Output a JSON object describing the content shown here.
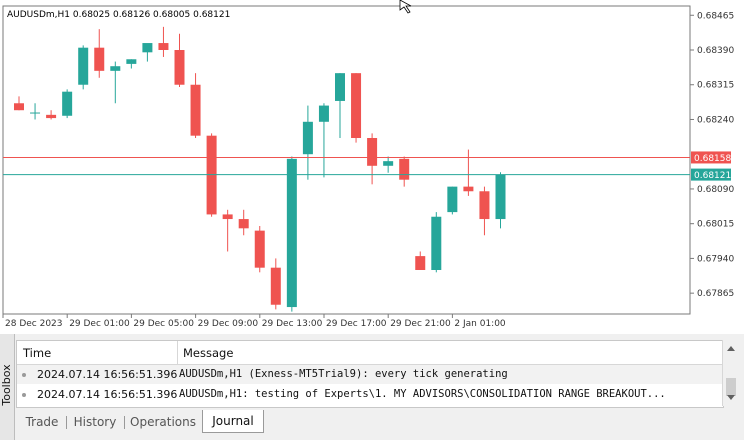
{
  "chart": {
    "symbol_info": "AUDUSDm,H1  0.68025 0.68126 0.68005 0.68121",
    "bid_label": "0.68121",
    "ask_label": "0.68158",
    "bull_color": "#26a69a",
    "bear_color": "#ef5350",
    "bid_line_color": "#26a69a",
    "ask_line_color": "#ef5350"
  },
  "chart_data": {
    "type": "candlestick",
    "symbol": "AUDUSDm",
    "timeframe": "H1",
    "ylim": [
      0.6782,
      0.68485
    ],
    "y_ticks": [
      "0.68465",
      "0.68390",
      "0.68315",
      "0.68240",
      "0.68090",
      "0.68015",
      "0.67940",
      "0.67865"
    ],
    "x_ticks": [
      "28 Dec 2023",
      "29 Dec 01:00",
      "29 Dec 05:00",
      "29 Dec 09:00",
      "29 Dec 13:00",
      "29 Dec 17:00",
      "29 Dec 21:00",
      "2 Jan 01:00"
    ],
    "candles": [
      {
        "o": 0.68275,
        "h": 0.6829,
        "l": 0.6826,
        "c": 0.6826
      },
      {
        "o": 0.68255,
        "h": 0.68275,
        "l": 0.6824,
        "c": 0.68255
      },
      {
        "o": 0.6825,
        "h": 0.6826,
        "l": 0.6824,
        "c": 0.68243
      },
      {
        "o": 0.68248,
        "h": 0.68305,
        "l": 0.68243,
        "c": 0.683
      },
      {
        "o": 0.68315,
        "h": 0.684,
        "l": 0.68305,
        "c": 0.68395
      },
      {
        "o": 0.68395,
        "h": 0.68435,
        "l": 0.6833,
        "c": 0.68345
      },
      {
        "o": 0.68345,
        "h": 0.68365,
        "l": 0.68275,
        "c": 0.68355
      },
      {
        "o": 0.6836,
        "h": 0.6837,
        "l": 0.6835,
        "c": 0.6837
      },
      {
        "o": 0.68385,
        "h": 0.68395,
        "l": 0.68365,
        "c": 0.68405
      },
      {
        "o": 0.68405,
        "h": 0.6844,
        "l": 0.68375,
        "c": 0.6839
      },
      {
        "o": 0.6839,
        "h": 0.68425,
        "l": 0.6831,
        "c": 0.68315
      },
      {
        "o": 0.68315,
        "h": 0.6834,
        "l": 0.682,
        "c": 0.68205
      },
      {
        "o": 0.68205,
        "h": 0.6821,
        "l": 0.6803,
        "c": 0.68035
      },
      {
        "o": 0.68035,
        "h": 0.68045,
        "l": 0.67955,
        "c": 0.68025
      },
      {
        "o": 0.68025,
        "h": 0.68045,
        "l": 0.6799,
        "c": 0.68005
      },
      {
        "o": 0.68,
        "h": 0.6801,
        "l": 0.6791,
        "c": 0.6792
      },
      {
        "o": 0.6792,
        "h": 0.6794,
        "l": 0.6783,
        "c": 0.6784
      },
      {
        "o": 0.67835,
        "h": 0.6816,
        "l": 0.67825,
        "c": 0.68155
      },
      {
        "o": 0.68165,
        "h": 0.6827,
        "l": 0.6811,
        "c": 0.68235
      },
      {
        "o": 0.68235,
        "h": 0.68275,
        "l": 0.68115,
        "c": 0.6827
      },
      {
        "o": 0.6828,
        "h": 0.6834,
        "l": 0.682,
        "c": 0.6834
      },
      {
        "o": 0.6834,
        "h": 0.6834,
        "l": 0.6819,
        "c": 0.682
      },
      {
        "o": 0.682,
        "h": 0.6821,
        "l": 0.681,
        "c": 0.6814
      },
      {
        "o": 0.6814,
        "h": 0.6816,
        "l": 0.68125,
        "c": 0.6815
      },
      {
        "o": 0.68155,
        "h": 0.6816,
        "l": 0.68095,
        "c": 0.6811
      },
      {
        "o": 0.67945,
        "h": 0.67955,
        "l": 0.67915,
        "c": 0.67915
      },
      {
        "o": 0.67915,
        "h": 0.6804,
        "l": 0.6791,
        "c": 0.6803
      },
      {
        "o": 0.6804,
        "h": 0.68095,
        "l": 0.68035,
        "c": 0.68095
      },
      {
        "o": 0.68095,
        "h": 0.68175,
        "l": 0.68075,
        "c": 0.68085
      },
      {
        "o": 0.68085,
        "h": 0.68095,
        "l": 0.6799,
        "c": 0.68025
      },
      {
        "o": 0.68025,
        "h": 0.68126,
        "l": 0.68005,
        "c": 0.68121
      }
    ],
    "bid": 0.68121,
    "ask": 0.68158
  },
  "toolbox": {
    "side_label": "Toolbox",
    "columns": {
      "time": "Time",
      "message": "Message"
    },
    "rows": [
      {
        "time": "2024.07.14 16:56:51.396",
        "message": "AUDUSDm,H1 (Exness-MT5Trial9): every tick generating"
      },
      {
        "time": "2024.07.14 16:56:51.396",
        "message": "AUDUSDm,H1: testing of Experts\\1. MY ADVISORS\\CONSOLIDATION RANGE BREAKOUT..."
      }
    ],
    "tabs": [
      "Trade",
      "History",
      "Operations",
      "Journal"
    ],
    "active_tab": "Journal"
  }
}
